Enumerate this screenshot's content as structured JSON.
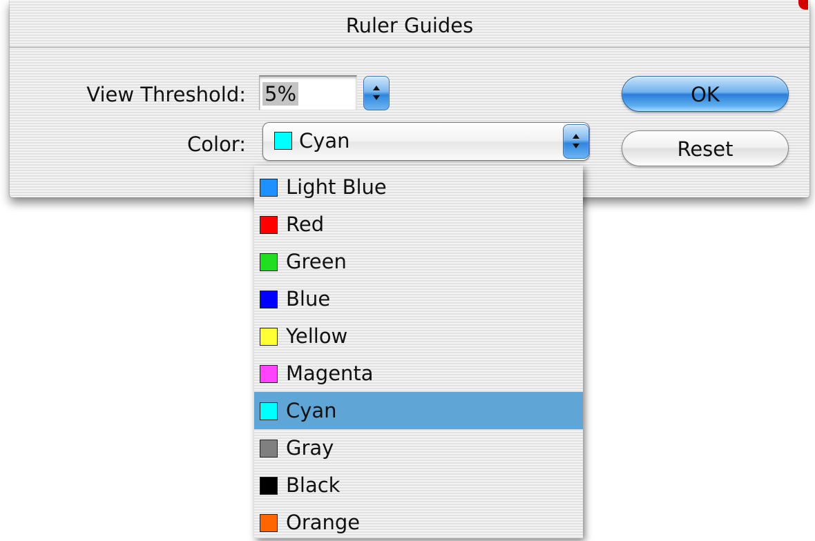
{
  "dialog": {
    "title": "Ruler Guides",
    "view_threshold": {
      "label": "View Threshold:",
      "value": "5%"
    },
    "color": {
      "label": "Color:",
      "selected": "Cyan",
      "selected_color": "#00ffff"
    },
    "buttons": {
      "ok": "OK",
      "reset": "Reset"
    }
  },
  "menu": {
    "items": [
      {
        "label": "Light Blue",
        "color": "#1e90ff",
        "selected": false
      },
      {
        "label": "Red",
        "color": "#ff0000",
        "selected": false
      },
      {
        "label": "Green",
        "color": "#22dd22",
        "selected": false
      },
      {
        "label": "Blue",
        "color": "#0000ff",
        "selected": false
      },
      {
        "label": "Yellow",
        "color": "#ffff33",
        "selected": false
      },
      {
        "label": "Magenta",
        "color": "#ff44ff",
        "selected": false
      },
      {
        "label": "Cyan",
        "color": "#00ffff",
        "selected": true
      },
      {
        "label": "Gray",
        "color": "#808080",
        "selected": false
      },
      {
        "label": "Black",
        "color": "#000000",
        "selected": false
      },
      {
        "label": "Orange",
        "color": "#ff6600",
        "selected": false
      }
    ]
  }
}
